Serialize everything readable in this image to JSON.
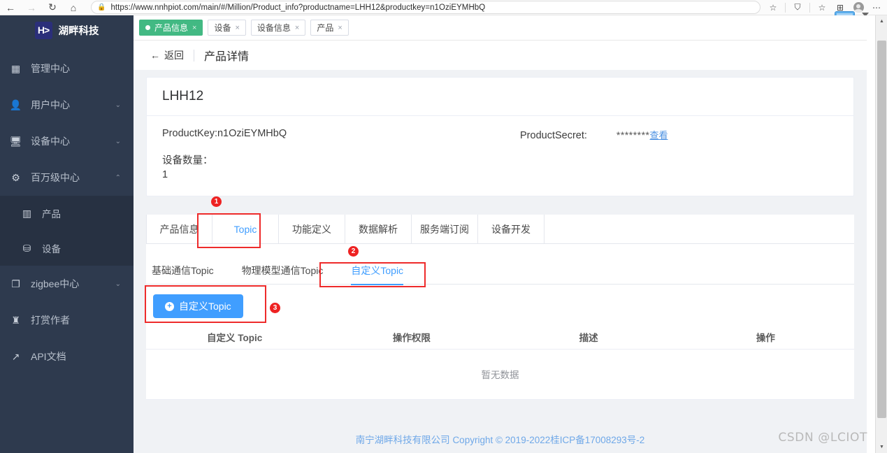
{
  "browser": {
    "url": "https://www.nnhpiot.com/main/#/Million/Product_info?productname=LHH12&productkey=n1OziEYMHbQ",
    "back_icon": "←",
    "forward_icon": "→",
    "reload_icon": "↻",
    "home_icon": "⌂",
    "lock_icon": "🔒",
    "favorite_icon": "☆",
    "extensions_icon": "⛉",
    "collections_icon": "☆",
    "split_icon": "⊞",
    "more_icon": "⋯"
  },
  "sidebar": {
    "logo_mark": "H>",
    "logo_text": "湖畔科技",
    "items": [
      {
        "label": "管理中心",
        "icon": "▦",
        "arrow": ""
      },
      {
        "label": "用户中心",
        "icon": "👤",
        "arrow": "⌄"
      },
      {
        "label": "设备中心",
        "icon": "🖥",
        "arrow": "⌄"
      },
      {
        "label": "百万级中心",
        "icon": "⚙",
        "arrow": "⌃"
      }
    ],
    "submenu": [
      {
        "label": "产品",
        "icon": "▥"
      },
      {
        "label": "设备",
        "icon": "⛁"
      }
    ],
    "items_after": [
      {
        "label": "zigbee中心",
        "icon": "❐",
        "arrow": "⌄"
      },
      {
        "label": "打赏作者",
        "icon": "♜",
        "arrow": ""
      },
      {
        "label": "API文档",
        "icon": "↗",
        "arrow": ""
      }
    ]
  },
  "view_tabs": [
    {
      "label": "产品信息",
      "active": true,
      "close": "×"
    },
    {
      "label": "设备",
      "active": false,
      "close": "×"
    },
    {
      "label": "设备信息",
      "active": false,
      "close": "×"
    },
    {
      "label": "产品",
      "active": false,
      "close": "×"
    }
  ],
  "breadcrumb": {
    "back_arrow": "←",
    "back_label": "返回",
    "title": "产品详情"
  },
  "product": {
    "name": "LHH12",
    "product_key_label": "ProductKey:n1OziEYMHbQ",
    "product_secret_label": "ProductSecret:",
    "product_secret_value": "********",
    "view_link": "查看",
    "device_count_label": "设备数量：",
    "device_count_value": "1"
  },
  "detail_tabs": [
    {
      "label": "产品信息",
      "active": false
    },
    {
      "label": "Topic",
      "active": true
    },
    {
      "label": "功能定义",
      "active": false
    },
    {
      "label": "数据解析",
      "active": false
    },
    {
      "label": "服务端订阅",
      "active": false
    },
    {
      "label": "设备开发",
      "active": false
    }
  ],
  "topic_subtabs": [
    {
      "label": "基础通信Topic",
      "active": false
    },
    {
      "label": "物理模型通信Topic",
      "active": false
    },
    {
      "label": "自定义Topic",
      "active": true
    }
  ],
  "actions": {
    "add_topic_label": "自定义Topic",
    "add_topic_icon": "+"
  },
  "table": {
    "headers": [
      "自定义 Topic",
      "操作权限",
      "描述",
      "操作"
    ],
    "rows": [],
    "empty_text": "暂无数据"
  },
  "footer": {
    "text": "南宁湖畔科技有限公司 Copyright © 2019-2022桂ICP备17008293号-2"
  },
  "watermark": {
    "text": "CSDN @LCIOT"
  },
  "annotations": [
    {
      "number": "1"
    },
    {
      "number": "2"
    },
    {
      "number": "3"
    }
  ],
  "scrollbar": {
    "up": "▲",
    "down": "▼"
  }
}
